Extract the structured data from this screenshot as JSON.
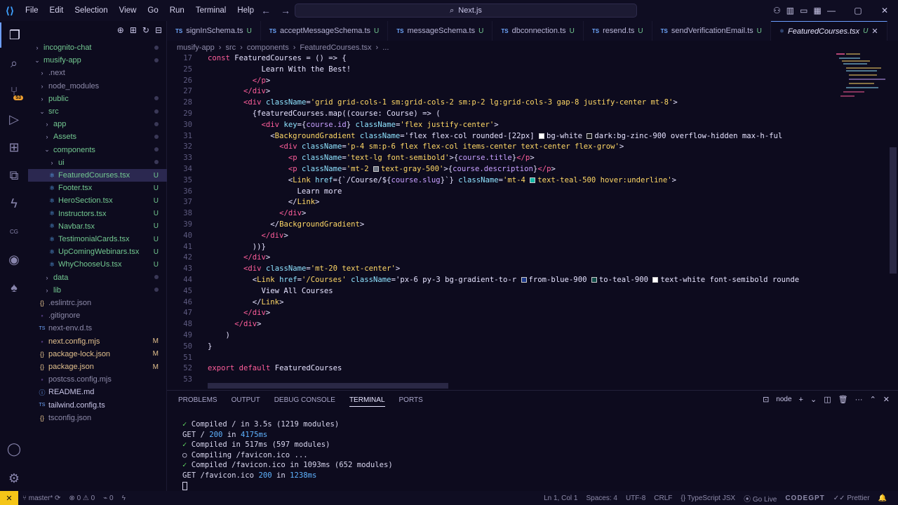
{
  "titlebar": {
    "menu": [
      "File",
      "Edit",
      "Selection",
      "View",
      "Go",
      "Run",
      "Terminal",
      "Help"
    ],
    "search": "Next.js"
  },
  "sidebar": {
    "items": [
      {
        "label": "incognito-chat",
        "indent": 0,
        "chev": "›",
        "status": "dot"
      },
      {
        "label": "musify-app",
        "indent": 0,
        "chev": "⌄",
        "status": "dot"
      },
      {
        "label": ".next",
        "indent": 1,
        "chev": "›",
        "status": ""
      },
      {
        "label": "node_modules",
        "indent": 1,
        "chev": "›",
        "status": ""
      },
      {
        "label": "public",
        "indent": 1,
        "chev": "›",
        "status": "dot"
      },
      {
        "label": "src",
        "indent": 1,
        "chev": "⌄",
        "status": "dot"
      },
      {
        "label": "app",
        "indent": 2,
        "chev": "›",
        "status": "dot"
      },
      {
        "label": "Assets",
        "indent": 2,
        "chev": "›",
        "status": "dot"
      },
      {
        "label": "components",
        "indent": 2,
        "chev": "⌄",
        "status": "dot"
      },
      {
        "label": "ui",
        "indent": 3,
        "chev": "›",
        "status": "dot"
      },
      {
        "label": "FeaturedCourses.tsx",
        "indent": 3,
        "chev": "",
        "status": "U",
        "selected": true
      },
      {
        "label": "Footer.tsx",
        "indent": 3,
        "chev": "",
        "status": "U"
      },
      {
        "label": "HeroSection.tsx",
        "indent": 3,
        "chev": "",
        "status": "U"
      },
      {
        "label": "Instructors.tsx",
        "indent": 3,
        "chev": "",
        "status": "U"
      },
      {
        "label": "Navbar.tsx",
        "indent": 3,
        "chev": "",
        "status": "U"
      },
      {
        "label": "TestimonialCards.tsx",
        "indent": 3,
        "chev": "",
        "status": "U"
      },
      {
        "label": "UpComingWebinars.tsx",
        "indent": 3,
        "chev": "",
        "status": "U"
      },
      {
        "label": "WhyChooseUs.tsx",
        "indent": 3,
        "chev": "",
        "status": "U"
      },
      {
        "label": "data",
        "indent": 2,
        "chev": "›",
        "status": "dot"
      },
      {
        "label": "lib",
        "indent": 2,
        "chev": "›",
        "status": "dot"
      },
      {
        "label": ".eslintrc.json",
        "indent": 1,
        "chev": "",
        "status": ""
      },
      {
        "label": ".gitignore",
        "indent": 1,
        "chev": "",
        "status": ""
      },
      {
        "label": "next-env.d.ts",
        "indent": 1,
        "chev": "",
        "status": ""
      },
      {
        "label": "next.config.mjs",
        "indent": 1,
        "chev": "",
        "status": "M"
      },
      {
        "label": "package-lock.json",
        "indent": 1,
        "chev": "",
        "status": "M"
      },
      {
        "label": "package.json",
        "indent": 1,
        "chev": "",
        "status": "M"
      },
      {
        "label": "postcss.config.mjs",
        "indent": 1,
        "chev": "",
        "status": ""
      },
      {
        "label": "README.md",
        "indent": 1,
        "chev": "",
        "status": ""
      },
      {
        "label": "tailwind.config.ts",
        "indent": 1,
        "chev": "",
        "status": ""
      },
      {
        "label": "tsconfig.json",
        "indent": 1,
        "chev": "",
        "status": ""
      }
    ]
  },
  "tabs": [
    {
      "label": "signInSchema.ts",
      "status": "U"
    },
    {
      "label": "acceptMessageSchema.ts",
      "status": "U"
    },
    {
      "label": "messageSchema.ts",
      "status": "U"
    },
    {
      "label": "dbconnection.ts",
      "status": "U"
    },
    {
      "label": "resend.ts",
      "status": "U"
    },
    {
      "label": "sendVerificationEmail.ts",
      "status": "U"
    },
    {
      "label": "FeaturedCourses.tsx",
      "status": "U",
      "active": true
    }
  ],
  "breadcrumbs": [
    "musify-app",
    "src",
    "components",
    "FeaturedCourses.tsx",
    "..."
  ],
  "editor": {
    "line_numbers": [
      "17",
      "25",
      "26",
      "27",
      "28",
      "29",
      "30",
      "31",
      "32",
      "33",
      "34",
      "35",
      "36",
      "37",
      "38",
      "39",
      "40",
      "41",
      "42",
      "43",
      "44",
      "45",
      "46",
      "47",
      "48",
      "49",
      "50",
      "51",
      "52",
      "53"
    ],
    "lines": [
      "const FeaturedCourses = () => {",
      "            Learn With the Best!",
      "          </p>",
      "        </div>",
      "        <div className='grid grid-cols-1 sm:grid-cols-2 sm:p-2 lg:grid-cols-3 gap-8 justify-center mt-8'>",
      "          {featuredCourses.map((course: Course) => (",
      "            <div key={course.id} className='flex justify-center'>",
      "              <BackgroundGradient className='flex flex-col rounded-[22px] bg-white dark:bg-zinc-900 overflow-hidden max-h-ful",
      "                <div className='p-4 sm:p-6 flex flex-col items-center text-center flex-grow'>",
      "                  <p className='text-lg font-semibold'>{course.title}</p>",
      "                  <p className='mt-2 text-gray-500'>{course.description}</p>",
      "                  <Link href={`/Course/${course.slug}`} className='mt-4 text-teal-500 hover:underline'>",
      "                    Learn more",
      "                  </Link>",
      "                </div>",
      "              </BackgroundGradient>",
      "            </div>",
      "          ))}",
      "        </div>",
      "        <div className='mt-20 text-center'>",
      "          <Link href='/Courses' className='px-6 py-3 bg-gradient-to-r from-blue-900 to-teal-900 text-white font-semibold rounde",
      "            View All Courses",
      "          </Link>",
      "        </div>",
      "      </div>",
      "    )",
      "}",
      "",
      "export default FeaturedCourses",
      ""
    ]
  },
  "panel": {
    "tabs": [
      "PROBLEMS",
      "OUTPUT",
      "DEBUG CONSOLE",
      "TERMINAL",
      "PORTS"
    ],
    "active_tab": "TERMINAL",
    "shell": "node",
    "terminal": [
      {
        "icon": "✓",
        "text": "Compiled / in 3.5s (1219 modules)"
      },
      {
        "icon": "",
        "text": "GET / 200 in 4175ms"
      },
      {
        "icon": "✓",
        "text": "Compiled in 517ms (597 modules)"
      },
      {
        "icon": "○",
        "text": "Compiling /favicon.ico ..."
      },
      {
        "icon": "✓",
        "text": "Compiled /favicon.ico in 1093ms (652 modules)"
      },
      {
        "icon": "",
        "text": "GET /favicon.ico 200 in 1238ms"
      }
    ]
  },
  "statusbar": {
    "branch": "master*",
    "errors": "0",
    "warnings": "0",
    "ports": "0",
    "position": "Ln 1, Col 1",
    "spaces": "Spaces: 4",
    "encoding": "UTF-8",
    "eol": "CRLF",
    "language": "TypeScript JSX",
    "golive": "Go Live",
    "codegpt": "CODEGPT",
    "prettier": "Prettier"
  },
  "colors": {
    "accent": "#6d9dff",
    "background": "#0d0b1e",
    "git_untracked": "#73c991",
    "git_modified": "#e2c08d"
  }
}
